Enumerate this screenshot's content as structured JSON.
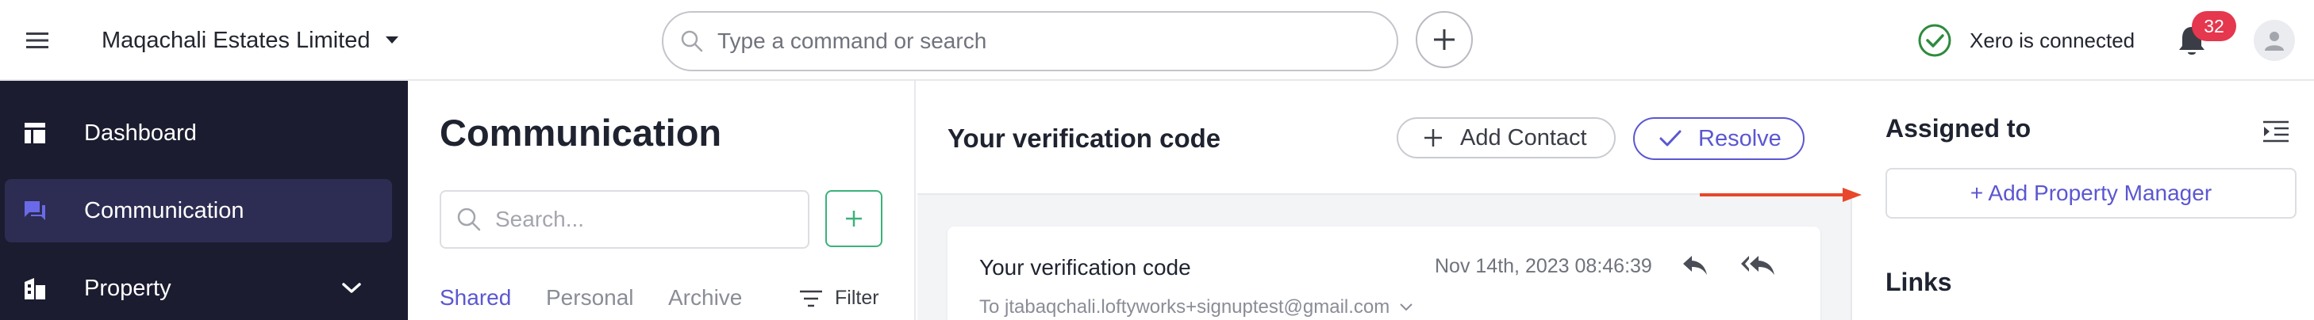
{
  "topbar": {
    "org_name": "Maqachali Estates Limited",
    "search_placeholder": "Type a command or search",
    "xero_status": "Xero is connected",
    "notification_count": "32",
    "icons": {
      "menu": "hamburger-icon",
      "org_caret": "caret-down-icon",
      "search": "search-icon",
      "add": "plus-icon",
      "xero": "check-circle-icon",
      "bell": "bell-icon",
      "avatar": "user-icon"
    }
  },
  "sidebar": {
    "items": [
      {
        "label": "Dashboard",
        "icon": "dashboard-icon",
        "active": false
      },
      {
        "label": "Communication",
        "icon": "chat-icon",
        "active": true
      },
      {
        "label": "Property",
        "icon": "building-icon",
        "active": false,
        "expandable": true
      }
    ]
  },
  "communication": {
    "title": "Communication",
    "search_placeholder": "Search...",
    "tabs": [
      {
        "label": "Shared",
        "active": true
      },
      {
        "label": "Personal",
        "active": false
      },
      {
        "label": "Archive",
        "active": false
      }
    ],
    "filter_label": "Filter"
  },
  "detail": {
    "title": "Your verification code",
    "add_contact_label": "Add Contact",
    "resolve_label": "Resolve",
    "message": {
      "subject": "Your verification code",
      "date": "Nov 14th, 2023 08:46:39",
      "to": "To jtabaqchali.loftyworks+signuptest@gmail.com"
    }
  },
  "right_panel": {
    "assigned_title": "Assigned to",
    "add_pm_label": "+ Add Property Manager",
    "links_title": "Links"
  },
  "colors": {
    "accent": "#5b57d1",
    "sidebar_bg": "#1b1c2f",
    "sidebar_active": "#2d2c52",
    "success": "#2e8b3e",
    "badge": "#e5374d",
    "annotation_arrow": "#e8472b",
    "add_button_green": "#3bb27a"
  }
}
